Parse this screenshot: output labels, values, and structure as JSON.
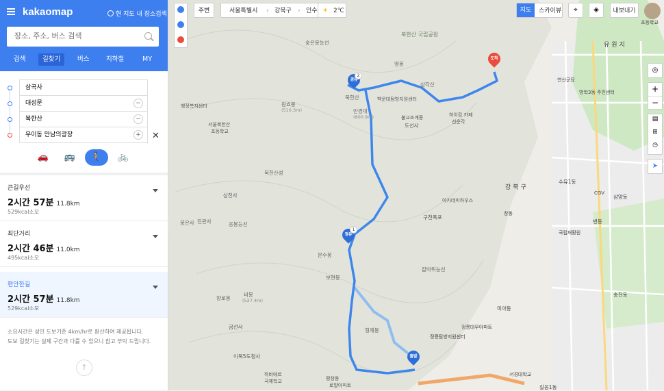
{
  "header": {
    "logo": "kakaomap",
    "near_search_label": "현 지도 내 장소검색"
  },
  "search": {
    "placeholder": "장소, 주소, 버스 검색"
  },
  "tabs": [
    {
      "label": "검색"
    },
    {
      "label": "길찾기"
    },
    {
      "label": "버스"
    },
    {
      "label": "지하철"
    },
    {
      "label": "MY"
    }
  ],
  "waypoints": [
    {
      "label": "삼곡사",
      "action": ""
    },
    {
      "label": "대성문",
      "action": "−"
    },
    {
      "label": "북한산",
      "action": "−"
    },
    {
      "label": "우이동 만남의광장",
      "action": "+"
    }
  ],
  "modes": [
    {
      "icon": "car-icon",
      "glyph": "🚗"
    },
    {
      "icon": "bus-icon",
      "glyph": "🚌"
    },
    {
      "icon": "walk-icon",
      "glyph": "🚶"
    },
    {
      "icon": "bicycle-icon",
      "glyph": "🚲"
    }
  ],
  "route_options": [
    {
      "name": "큰길우선",
      "time": "2시간 57분",
      "distance": "11.8km",
      "kcal": "529kcal소모"
    },
    {
      "name": "최단거리",
      "time": "2시간 46분",
      "distance": "11.0km",
      "kcal": "495kcal소모"
    },
    {
      "name": "편안한길",
      "time": "2시간 57분",
      "distance": "11.8km",
      "kcal": "529kcal소모"
    }
  ],
  "notice": {
    "line1": "소요시간은 성인 도보기준 4km/hr로 환산하여 제공됩니다.",
    "line2": "도보 길찾기는 실제 구간과 다를 수 있으니 참고 부탁 드립니다."
  },
  "map_toolbar": {
    "nearby": "주변",
    "breadcrumb": [
      "서울특별시",
      "강북구",
      "인수동"
    ],
    "weather": "2℃",
    "map_view": "지도",
    "skyview": "스카이뷰",
    "export": "내보내기",
    "user": "초등학교"
  },
  "pins": {
    "start": "출발",
    "via1": "경유",
    "via1_num": "1",
    "via2": "경유",
    "via2_num": "2",
    "end": "도착"
  },
  "map_labels": [
    "북한산 국립공원",
    "영봉",
    "숭은봉능선",
    "원효봉",
    "(510.3m)",
    "북한산",
    "만경대",
    "(800.9m)",
    "백운대탐방지원센터",
    "삼각산",
    "북한산",
    "도선사",
    "불교조계종",
    "하이킹 카페",
    "선운각",
    "행정복지센터",
    "서울북한산",
    "초등학교",
    "북한산성",
    "삼천사",
    "응봉능선",
    "진관사",
    "봉은사",
    "구천폭포",
    "아카데미하우스",
    "칼바위능선",
    "문수봉",
    "보현봉",
    "비봉",
    "(527.4m)",
    "향로봉",
    "금선사",
    "형제봉",
    "이북5도청사",
    "평창동",
    "롯데캐슬",
    "로얄아파트",
    "하비에르",
    "국제학교",
    "강북구",
    "수유1동",
    "삼양동",
    "번동",
    "우이동",
    "쌍문동",
    "도봉구",
    "방학3동",
    "창동",
    "국립재활원",
    "대한병원",
    "송천동",
    "미아동",
    "길음1동",
    "CGV",
    "서경대학교",
    "정릉탐방지원센터",
    "정릉대우아파트",
    "연산군묘",
    "방학3동 주민센터",
    "인수봉",
    "도봉구청",
    "유원지"
  ]
}
